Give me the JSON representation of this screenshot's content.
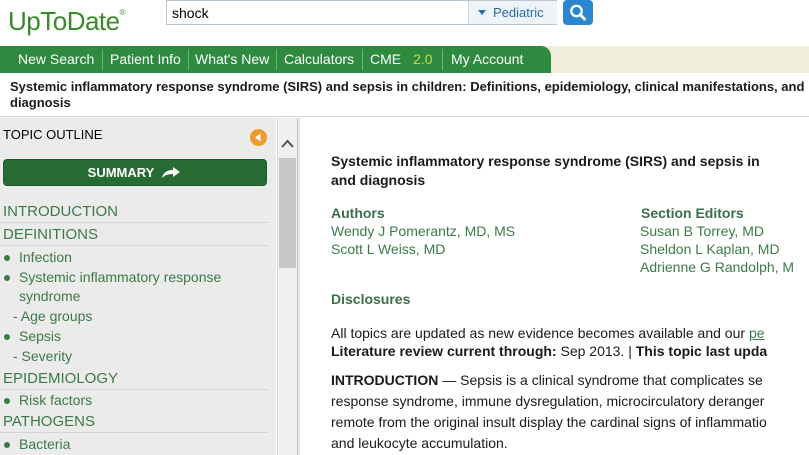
{
  "header": {
    "logo": "UpToDate",
    "logo_mark": "®",
    "search_value": "shock",
    "population": "Pediatric"
  },
  "nav": {
    "items": [
      "New Search",
      "Patient Info",
      "What's New",
      "Calculators",
      "CME",
      "My Account"
    ],
    "cme_value": "2.0"
  },
  "topic": {
    "title_line1": "Systemic inflammatory response syndrome (SIRS) and sepsis in children: Definitions, epidemiology, clinical manifestations, and",
    "title_line2": "diagnosis"
  },
  "sidebar": {
    "heading": "TOPIC OUTLINE",
    "summary_label": "SUMMARY",
    "outline": [
      {
        "label": "INTRODUCTION"
      },
      {
        "label": "DEFINITIONS"
      },
      {
        "label": "Infection"
      },
      {
        "label": "Systemic inflammatory response"
      },
      {
        "label": "syndrome"
      },
      {
        "label": "- Age groups"
      },
      {
        "label": "Sepsis"
      },
      {
        "label": "- Severity"
      },
      {
        "label": "EPIDEMIOLOGY"
      },
      {
        "label": "Risk factors"
      },
      {
        "label": "PATHOGENS"
      },
      {
        "label": "Bacteria"
      }
    ]
  },
  "content": {
    "title_line1": "Systemic inflammatory response syndrome (SIRS) and sepsis in",
    "title_line2": "and diagnosis",
    "authors_heading": "Authors",
    "authors": [
      "Wendy J Pomerantz, MD, MS",
      "Scott L Weiss, MD"
    ],
    "editors_heading": "Section Editors",
    "editors": [
      "Susan B Torrey, MD",
      "Sheldon L Kaplan, MD",
      "Adrienne G Randolph, M"
    ],
    "disclosures": "Disclosures",
    "update_text": "All topics are updated as new evidence becomes available and our ",
    "update_link": "pe",
    "review_label": "Literature review current through:",
    "review_value": " Sep 2013. | ",
    "last_updated_label": "This topic last upda",
    "intro_label": "INTRODUCTION",
    "intro_line1": " — Sepsis is a clinical syndrome that complicates se",
    "intro_line2": "response syndrome, immune dysregulation, microcirculatory deranger",
    "intro_line3": "remote from the original insult display the cardinal signs of inflammatio",
    "intro_line4": "and leukocyte accumulation."
  },
  "colors": {
    "brand_green": "#2d8a3e",
    "link_green": "#3b7a47",
    "search_blue": "#2a86d0",
    "accent_orange": "#f39a2c"
  }
}
